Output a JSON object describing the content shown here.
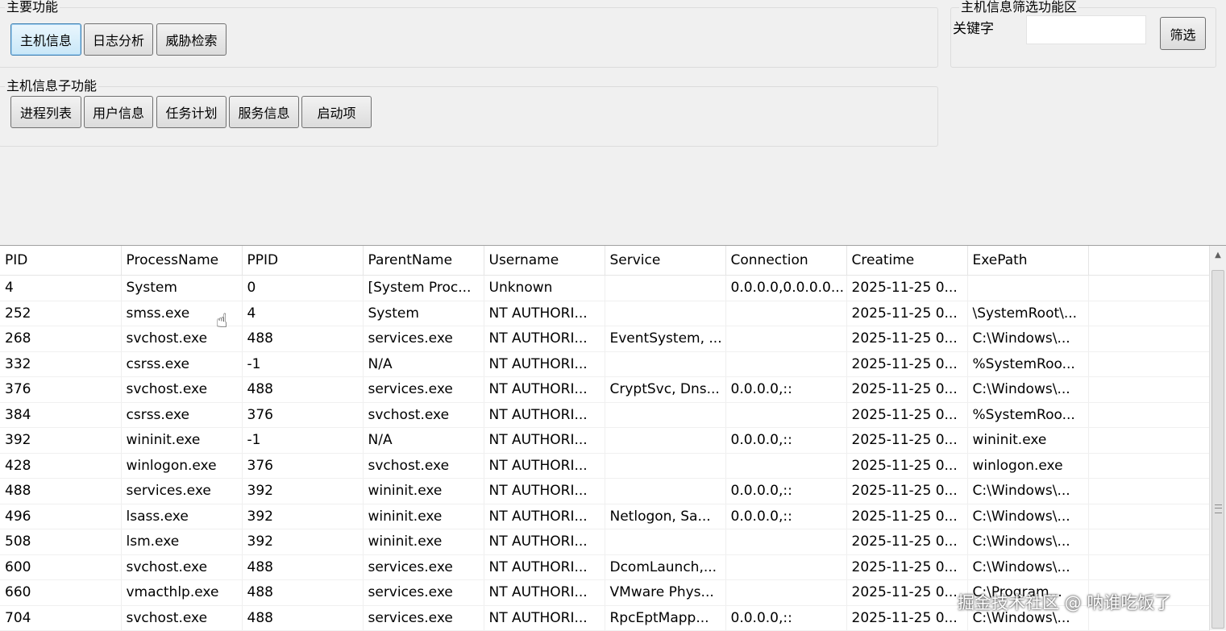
{
  "main_functions": {
    "title": "主要功能",
    "buttons": [
      {
        "label": "主机信息",
        "active": true
      },
      {
        "label": "日志分析",
        "active": false
      },
      {
        "label": "威胁检索",
        "active": false
      }
    ]
  },
  "sub_functions": {
    "title": "主机信息子功能",
    "buttons": [
      {
        "label": "进程列表"
      },
      {
        "label": "用户信息"
      },
      {
        "label": "任务计划"
      },
      {
        "label": "服务信息"
      },
      {
        "label": "启动项"
      }
    ]
  },
  "filter": {
    "title": "主机信息筛选功能区",
    "keyword_label": "关键字",
    "keyword_value": "",
    "button_label": "筛选"
  },
  "table": {
    "columns": [
      "PID",
      "ProcessName",
      "PPID",
      "ParentName",
      "Username",
      "Service",
      "Connection",
      "Creatime",
      "ExePath"
    ],
    "rows": [
      [
        "4",
        "System",
        "0",
        "[System Proc...",
        "Unknown",
        "",
        "0.0.0.0,0.0.0.0...",
        "2025-11-25 0...",
        ""
      ],
      [
        "252",
        "smss.exe",
        "4",
        "System",
        "NT AUTHORI...",
        "",
        "",
        "2025-11-25 0...",
        "\\SystemRoot\\..."
      ],
      [
        "268",
        "svchost.exe",
        "488",
        "services.exe",
        "NT AUTHORI...",
        "EventSystem, ...",
        "",
        "2025-11-25 0...",
        "C:\\Windows\\..."
      ],
      [
        "332",
        "csrss.exe",
        "-1",
        "N/A",
        "NT AUTHORI...",
        "",
        "",
        "2025-11-25 0...",
        "%SystemRoo..."
      ],
      [
        "376",
        "svchost.exe",
        "488",
        "services.exe",
        "NT AUTHORI...",
        "CryptSvc, Dns...",
        "0.0.0.0,::",
        "2025-11-25 0...",
        "C:\\Windows\\..."
      ],
      [
        "384",
        "csrss.exe",
        "376",
        "svchost.exe",
        "NT AUTHORI...",
        "",
        "",
        "2025-11-25 0...",
        "%SystemRoo..."
      ],
      [
        "392",
        "wininit.exe",
        "-1",
        "N/A",
        "NT AUTHORI...",
        "",
        "0.0.0.0,::",
        "2025-11-25 0...",
        "wininit.exe"
      ],
      [
        "428",
        "winlogon.exe",
        "376",
        "svchost.exe",
        "NT AUTHORI...",
        "",
        "",
        "2025-11-25 0...",
        "winlogon.exe"
      ],
      [
        "488",
        "services.exe",
        "392",
        "wininit.exe",
        "NT AUTHORI...",
        "",
        "0.0.0.0,::",
        "2025-11-25 0...",
        "C:\\Windows\\..."
      ],
      [
        "496",
        "lsass.exe",
        "392",
        "wininit.exe",
        "NT AUTHORI...",
        "Netlogon, Sa...",
        "0.0.0.0,::",
        "2025-11-25 0...",
        "C:\\Windows\\..."
      ],
      [
        "508",
        "lsm.exe",
        "392",
        "wininit.exe",
        "NT AUTHORI...",
        "",
        "",
        "2025-11-25 0...",
        "C:\\Windows\\..."
      ],
      [
        "600",
        "svchost.exe",
        "488",
        "services.exe",
        "NT AUTHORI...",
        "DcomLaunch,...",
        "",
        "2025-11-25 0...",
        "C:\\Windows\\..."
      ],
      [
        "660",
        "vmacthlp.exe",
        "488",
        "services.exe",
        "NT AUTHORI...",
        "VMware Phys...",
        "",
        "2025-11-25 0...",
        "C:\\Program..."
      ],
      [
        "704",
        "svchost.exe",
        "488",
        "services.exe",
        "NT AUTHORI...",
        "RpcEptMapp...",
        "0.0.0.0,::",
        "2025-11-25 0...",
        "C:\\Windows\\..."
      ]
    ]
  },
  "watermark": "掘金技术社区 @ 呐谁吃饭了"
}
